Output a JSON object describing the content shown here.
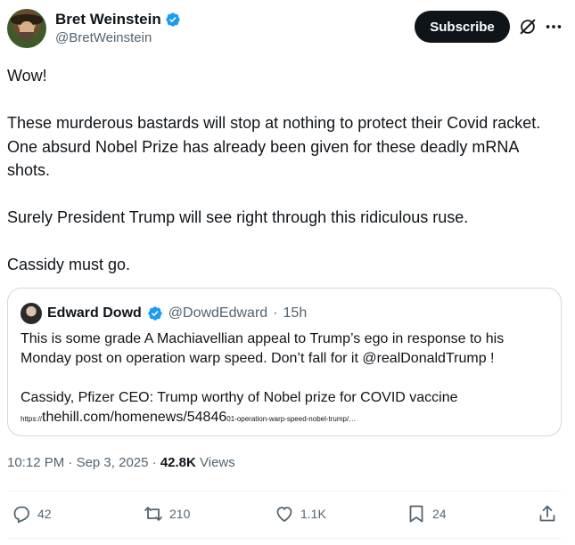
{
  "author": {
    "display_name": "Bret Weinstein",
    "handle": "@BretWeinstein",
    "verified_color": "#1d9bf0"
  },
  "header": {
    "subscribe_label": "Subscribe",
    "grok_icon": "grok-icon",
    "more_icon": "more-horizontal-icon"
  },
  "tweet": {
    "paragraphs": [
      "Wow!",
      "These murderous bastards will stop at nothing to protect their Covid racket. One absurd Nobel Prize has already been given for these deadly mRNA shots.",
      "Surely President Trump will see right through this ridiculous ruse.",
      "Cassidy must go."
    ]
  },
  "quote": {
    "display_name": "Edward Dowd",
    "handle": "@DowdEdward",
    "separator": "·",
    "time": "15h",
    "paragraphs": [
      "This is some grade A Machiavellian appeal to Trump’s ego in response to his Monday post on operation warp speed. Don’t fall for it @realDonaldTrump !",
      "Cassidy, Pfizer CEO: Trump worthy of Nobel prize for COVID vaccine"
    ],
    "link": {
      "prefix": "https://",
      "main": "thehill.com/homenews/54846",
      "suffix": "01-operation-warp-speed-nobel-trump/…"
    }
  },
  "meta": {
    "time": "10:12 PM",
    "separator": "·",
    "date": "Sep 3, 2025",
    "views_count": "42.8K",
    "views_label": "Views"
  },
  "actions": {
    "replies": "42",
    "reposts": "210",
    "likes": "1.1K",
    "bookmarks": "24"
  },
  "colors": {
    "text": "#0f1419",
    "secondary": "#536471",
    "border": "#cfd9de",
    "verified": "#1d9bf0",
    "subscribe_bg": "#0f1419"
  }
}
